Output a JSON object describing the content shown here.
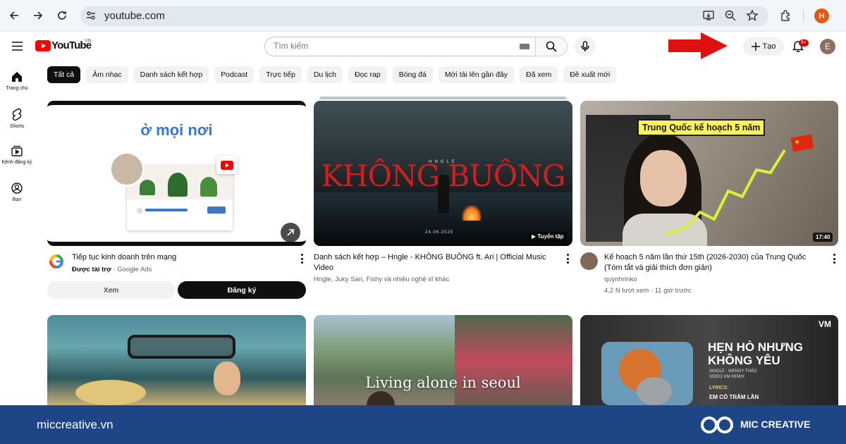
{
  "browser": {
    "url": "youtube.com",
    "profile_initial": "H"
  },
  "header": {
    "logo_text": "YouTube",
    "region": "VN",
    "search_placeholder": "Tìm kiếm",
    "create_label": "Tạo",
    "notification_count": "9+",
    "user_initial": "E"
  },
  "sidebar": {
    "items": [
      {
        "label": "Trang chủ",
        "icon": "home-icon"
      },
      {
        "label": "Shorts",
        "icon": "shorts-icon"
      },
      {
        "label": "Kênh đăng ký",
        "icon": "subscriptions-icon"
      },
      {
        "label": "Bạn",
        "icon": "you-icon"
      }
    ]
  },
  "chips": [
    "Tất cả",
    "Âm nhạc",
    "Danh sách kết hợp",
    "Podcast",
    "Trực tiếp",
    "Du lịch",
    "Đọc rap",
    "Bóng đá",
    "Mới tải lên gần đây",
    "Đã xem",
    "Đề xuất mới"
  ],
  "videos": [
    {
      "title": "Tiếp tục kinh doanh trên mạng",
      "sponsored": "Được tài trợ",
      "channel": "Google Ads",
      "thumb_heading": "ở mọi nơi",
      "ad_button_left": "Xem",
      "ad_button_right": "Đăng ký"
    },
    {
      "title_line1": "Danh sách kết hợp – Hngle - KHÔNG BUÔNG ft. Ari | Official Music",
      "title_line2": "Video",
      "meta": "Hngle, Juky San, Fishy và nhiều nghệ sĩ khác",
      "thumb_text": "KHÔNG BUÔNG",
      "thumb_artist": "HNGLE",
      "thumb_date": "24.06.2025",
      "badge": "Tuyển tập"
    },
    {
      "title_line1": "Kế hoạch 5 năm lần thứ 15th (2026-2030) của Trung Quốc",
      "title_line2": "(Tóm tắt và giải thích đơn giản)",
      "channel": "quynhrinko",
      "stats": "4,2 N lượt xem · 11 giờ trước",
      "thumb_banner": "Trung Quốc kế hoạch 5 năm",
      "duration": "17:40"
    }
  ],
  "row2": [
    {
      "thumb_text": ""
    },
    {
      "thumb_text": "Living alone in seoul"
    },
    {
      "thumb_text_line1": "HẸN HÒ NHƯNG",
      "thumb_text_line2": "KHÔNG YÊU",
      "thumb_sub": "SINGLE : WENDY THẢO",
      "thumb_sub2": "VIDEO VM REMIX",
      "thumb_lyrics": "LYRICS:",
      "thumb_lyrics_line": "EM CÓ TRĂM LẦN"
    }
  ],
  "footer": {
    "site": "miccreative.vn",
    "brand": "MIC CREATIVE"
  },
  "colors": {
    "youtube_red": "#ff0000",
    "arrow_red": "#e01010",
    "footer_blue": "#1e4586"
  }
}
